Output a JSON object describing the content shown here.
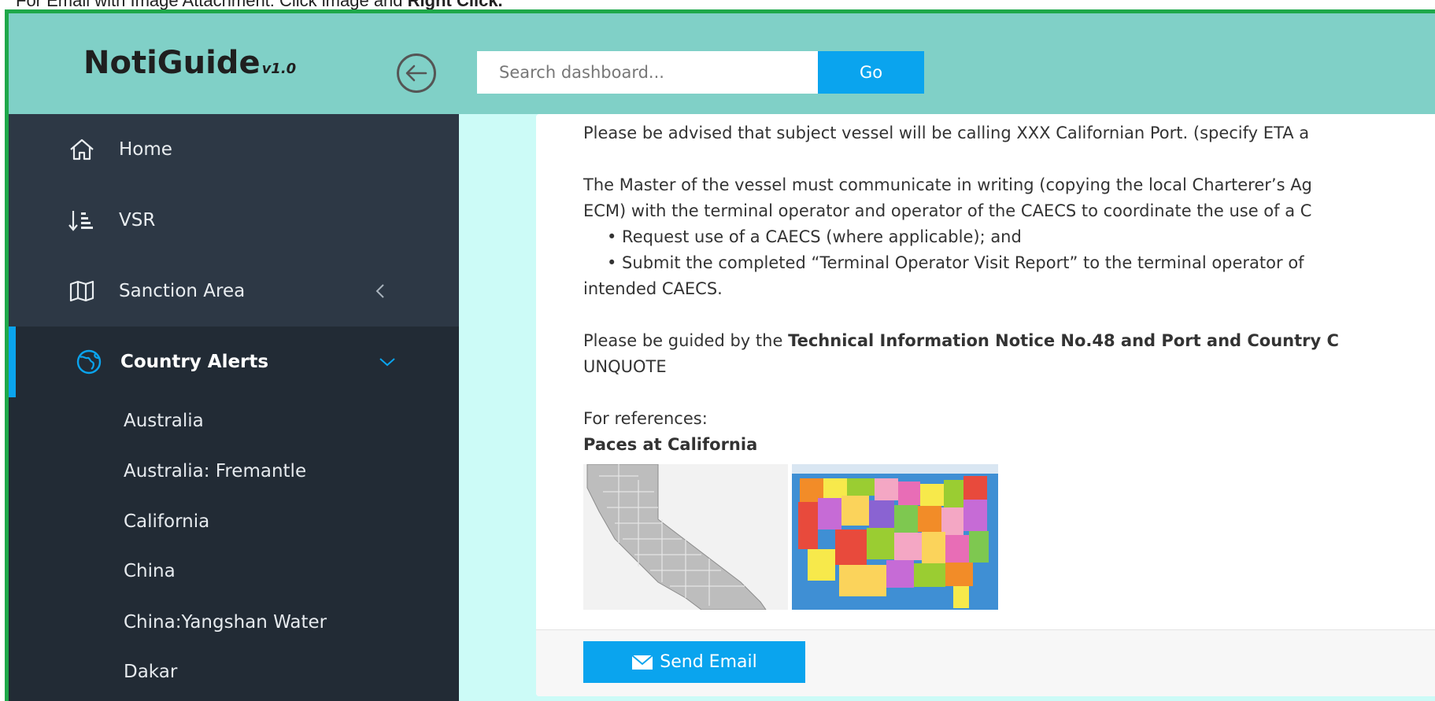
{
  "caption": {
    "prefix": "For Email with Image Attachment: Click image and ",
    "bold": "Right Click."
  },
  "header": {
    "brand": "NotiGuide",
    "version": "v1.0",
    "search_placeholder": "Search dashboard...",
    "go_label": "Go"
  },
  "sidebar": {
    "items": [
      {
        "label": "Home",
        "icon": "home-icon"
      },
      {
        "label": "VSR",
        "icon": "sort-icon"
      },
      {
        "label": "Sanction Area",
        "icon": "map-icon"
      },
      {
        "label": "Country Alerts",
        "icon": "globe-icon"
      }
    ],
    "sub_items": [
      "Australia",
      "Australia: Fremantle",
      "California",
      "China",
      "China:Yangshan Water",
      "Dakar"
    ]
  },
  "content": {
    "line1": "Please be advised that subject vessel will be calling XXX Californian Port. (specify ETA a",
    "line2": "The Master of the vessel must communicate in writing (copying the local Charterer’s Ag",
    "line3": "ECM) with the terminal operator and operator of the CAECS to coordinate the use of a C",
    "bullet1": "• Request use of a CAECS (where applicable); and",
    "bullet2": "• Submit the completed  “Terminal Operator Visit Report” to the terminal operator of",
    "line4": "intended CAECS.",
    "guided_prefix": "Please be guided by the ",
    "guided_bold": "Technical Information Notice No.48 and Port and Country C",
    "unquote": "UNQUOTE",
    "references": "For references:",
    "places": "Paces at California"
  },
  "actions": {
    "send_email": "Send Email"
  },
  "colors": {
    "header": "#80d0c7",
    "sidebar": "#222b35",
    "accent": "#0aa4ee",
    "frame": "#1ea84a"
  }
}
